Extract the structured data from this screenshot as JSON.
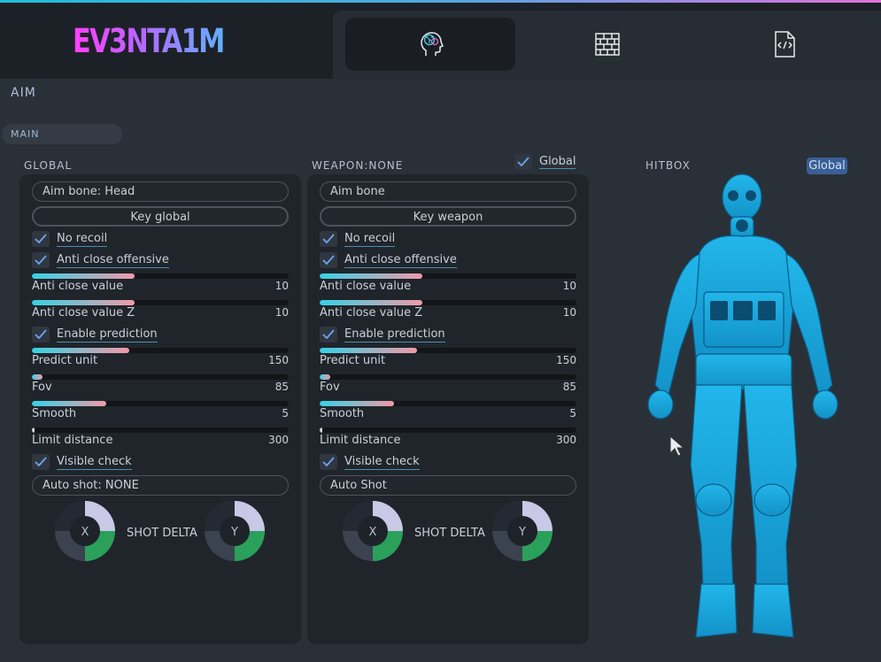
{
  "app": {
    "logo_text": "EV3NTA1M"
  },
  "tabs": [
    {
      "icon": "brain-head-icon",
      "active": true
    },
    {
      "icon": "brick-wall-icon",
      "active": false
    },
    {
      "icon": "code-file-icon",
      "active": false
    }
  ],
  "section_bar": {
    "label": "AIM"
  },
  "main_pill": {
    "label": "MAIN"
  },
  "global_panel": {
    "title": "GLOBAL",
    "aim_bone": "Aim bone: Head",
    "key_button": "Key global",
    "no_recoil": {
      "label": "No recoil",
      "checked": true
    },
    "anti_close_offensive": {
      "label": "Anti close offensive",
      "checked": true
    },
    "anti_close_value": {
      "label": "Anti close value",
      "value": "10",
      "fill_fraction": 0.4
    },
    "anti_close_value_z": {
      "label": "Anti close value Z",
      "value": "10",
      "fill_fraction": 0.4
    },
    "enable_prediction": {
      "label": "Enable prediction",
      "checked": true
    },
    "predict_unit": {
      "label": "Predict unit",
      "value": "150",
      "fill_fraction": 0.38
    },
    "fov": {
      "label": "Fov",
      "value": "85",
      "fill_fraction": 0.04
    },
    "smooth": {
      "label": "Smooth",
      "value": "5",
      "fill_fraction": 0.29
    },
    "limit_distance": {
      "label": "Limit distance",
      "value": "300",
      "fill_fraction": 0.01
    },
    "visible_check": {
      "label": "Visible check",
      "checked": true
    },
    "auto_shot": "Auto shot: NONE",
    "shot_delta": {
      "label": "SHOT DELTA",
      "x_label": "X",
      "y_label": "Y"
    }
  },
  "weapon_panel": {
    "title": "WEAPON:NONE",
    "global_toggle": {
      "label": "Global",
      "checked": true
    },
    "aim_bone": "Aim bone",
    "key_button": "Key weapon",
    "no_recoil": {
      "label": "No recoil",
      "checked": true
    },
    "anti_close_offensive": {
      "label": "Anti close offensive",
      "checked": true
    },
    "anti_close_value": {
      "label": "Anti close value",
      "value": "10",
      "fill_fraction": 0.4
    },
    "anti_close_value_z": {
      "label": "Anti close value Z",
      "value": "10",
      "fill_fraction": 0.4
    },
    "enable_prediction": {
      "label": "Enable prediction",
      "checked": true
    },
    "predict_unit": {
      "label": "Predict unit",
      "value": "150",
      "fill_fraction": 0.38
    },
    "fov": {
      "label": "Fov",
      "value": "85",
      "fill_fraction": 0.04
    },
    "smooth": {
      "label": "Smooth",
      "value": "5",
      "fill_fraction": 0.29
    },
    "limit_distance": {
      "label": "Limit distance",
      "value": "300",
      "fill_fraction": 0.01
    },
    "visible_check": {
      "label": "Visible check",
      "checked": true
    },
    "auto_shot": "Auto Shot",
    "shot_delta": {
      "label": "SHOT DELTA",
      "x_label": "X",
      "y_label": "Y"
    }
  },
  "hitbox": {
    "title": "HITBOX",
    "badge": "Global"
  },
  "colors": {
    "accent_cyan": "#36d2e6",
    "accent_pink": "#f09aa8",
    "figure_blue": "#1aa8e0",
    "badge_blue": "#3a5f96"
  }
}
